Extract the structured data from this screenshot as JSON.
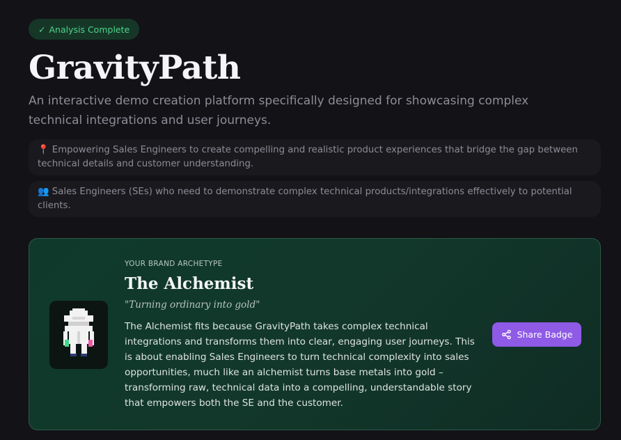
{
  "status_badge": {
    "check": "✓",
    "label": "Analysis Complete"
  },
  "title": "GravityPath",
  "subtitle": "An interactive demo creation platform specifically designed for showcasing complex technical integrations and user journeys.",
  "info_cards": [
    {
      "icon": "📍",
      "text": "Empowering Sales Engineers to create compelling and realistic product experiences that bridge the gap between technical details and customer understanding."
    },
    {
      "icon": "👥",
      "text": "Sales Engineers (SEs) who need to demonstrate complex technical products/integrations effectively to potential clients."
    }
  ],
  "archetype": {
    "eyebrow": "YOUR BRAND ARCHETYPE",
    "name": "The Alchemist",
    "tagline": "\"Turning ordinary into gold\"",
    "description": "The Alchemist fits because GravityPath takes complex technical integrations and transforms them into clear, engaging user journeys. This is about enabling Sales Engineers to turn technical complexity into sales opportunities, much like an alchemist turns base metals into gold – transforming raw, technical data into a compelling, understandable story that empowers both the SE and the customer.",
    "avatar_icon": "pixel-alchemist-icon"
  },
  "share_button": {
    "label": "Share Badge",
    "icon": "share-icon"
  },
  "colors": {
    "background": "#131217",
    "accent_green": "#4fd38c",
    "button_purple": "#8e5ae6",
    "card_green": "#0f3a2b"
  }
}
